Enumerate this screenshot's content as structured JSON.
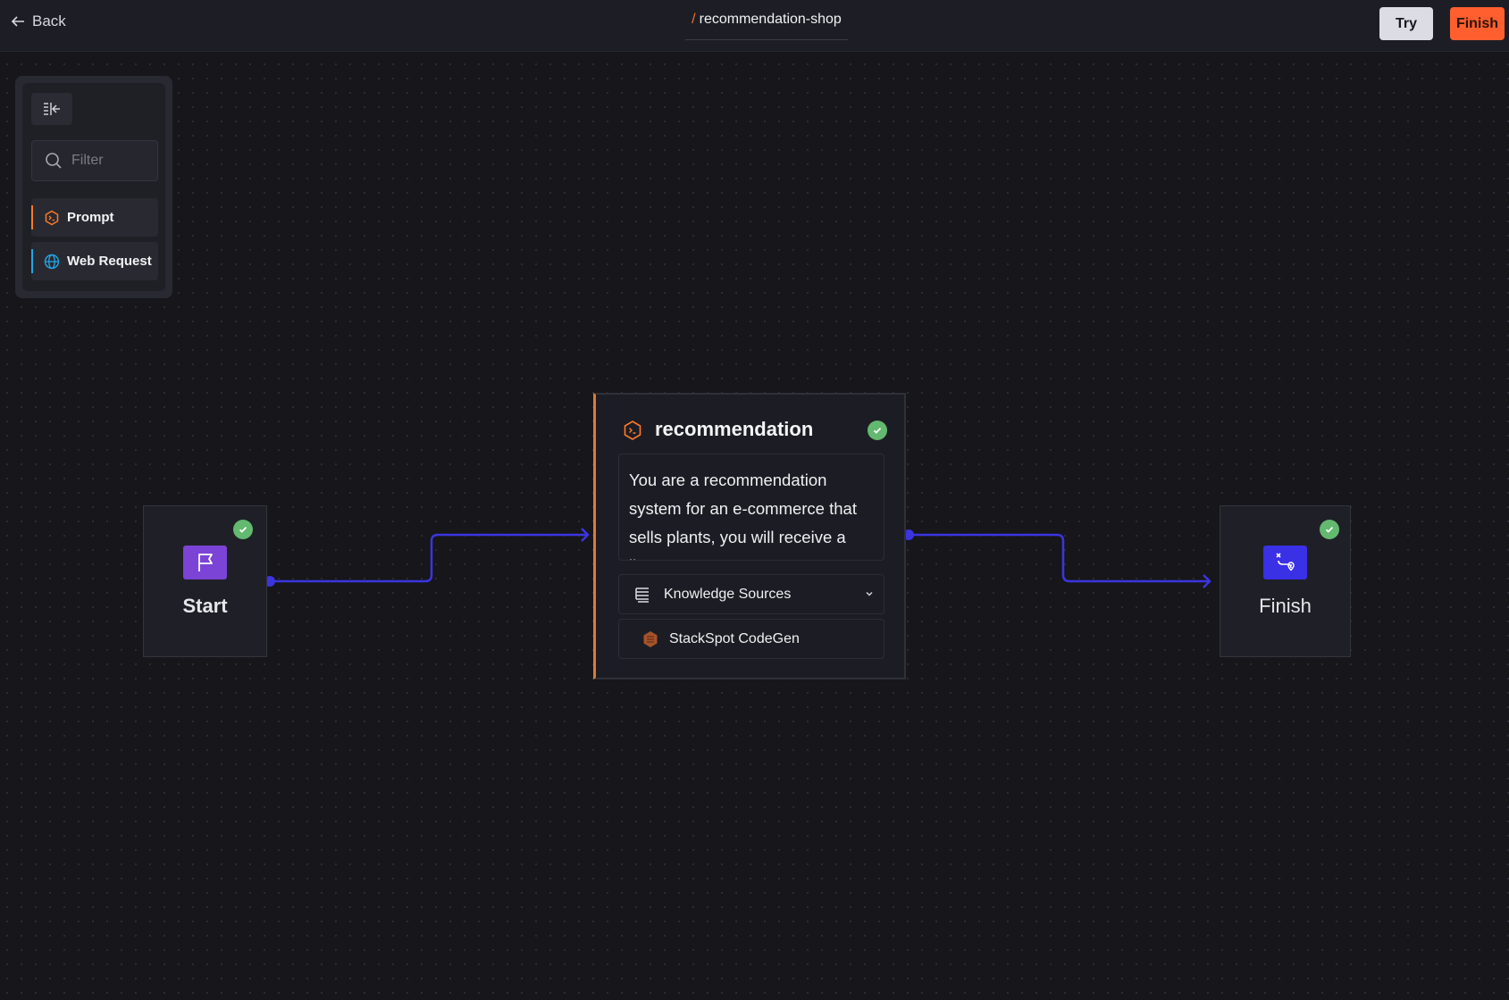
{
  "topbar": {
    "back_label": "Back",
    "breadcrumb_separator": "/",
    "project_name": "recommendation-shop",
    "try_label": "Try",
    "finish_label": "Finish"
  },
  "palette": {
    "filter_placeholder": "Filter",
    "items": [
      {
        "label": "Prompt",
        "icon": "prompt-hex-icon",
        "accent": "#ff7a29"
      },
      {
        "label": "Web Request",
        "icon": "globe-icon",
        "accent": "#23a6e8"
      }
    ]
  },
  "nodes": {
    "start": {
      "label": "Start",
      "icon": "flag-icon",
      "tile_color": "#7b43d6",
      "status": "ok"
    },
    "recommendation": {
      "title": "recommendation",
      "icon": "prompt-hex-icon",
      "status": "ok",
      "prompt_preview": "You are a recommendation system for an e-commerce that sells plants, you will receive a li…",
      "knowledge_sources_label": "Knowledge Sources",
      "knowledge_sources": [
        "StackSpot CodeGen"
      ]
    },
    "finish": {
      "label": "Finish",
      "icon": "route-icon",
      "tile_color": "#3a30e6",
      "status": "ok"
    }
  },
  "colors": {
    "accent_orange": "#ff5f2e",
    "edge_blue": "#3b35e0",
    "success_green": "#62b96f"
  }
}
